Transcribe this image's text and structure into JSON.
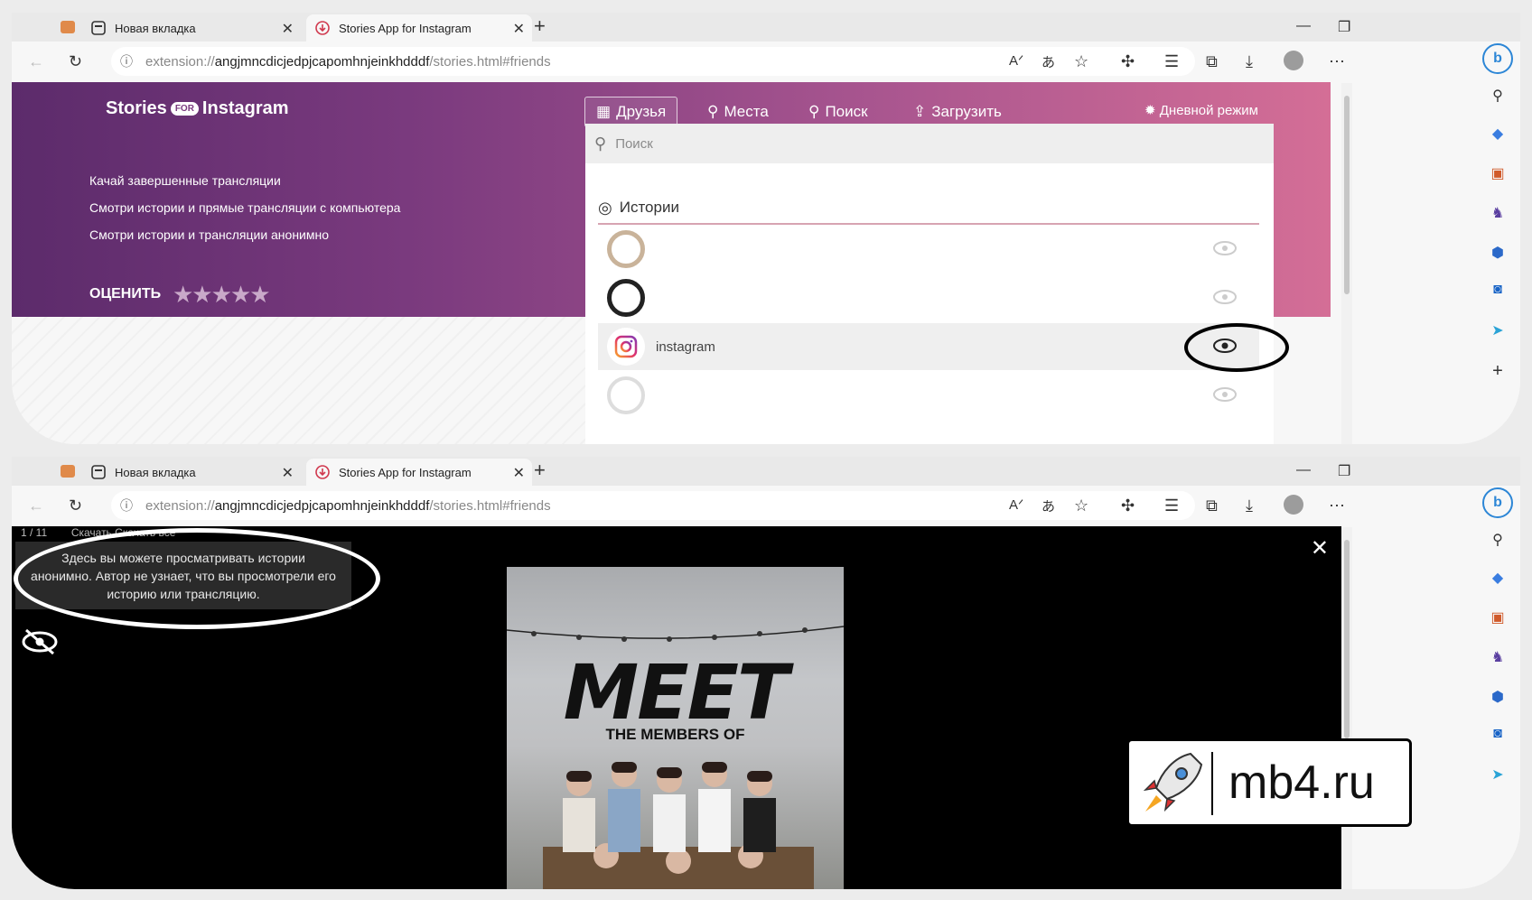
{
  "browser": {
    "tab1": {
      "label": "Новая вкладка"
    },
    "tab2": {
      "label": "Stories App for Instagram"
    },
    "url": {
      "prefix": "extension://",
      "host": "angjmncdicjedpjcapomhnjeinkhdddf",
      "path": "/stories.html#friends"
    }
  },
  "app": {
    "logo": {
      "left": "Stories",
      "badge": "FOR",
      "right": "Instagram"
    },
    "features": [
      "Качай завершенные трансляции",
      "Смотри истории и прямые трансляции с компьютера",
      "Смотри истории и трансляции анонимно"
    ],
    "rate_label": "ОЦЕНИТЬ",
    "stars": "★★★★★",
    "nav": {
      "friends": "Друзья",
      "places": "Места",
      "search": "Поиск",
      "upload": "Загрузить",
      "daymode": "Дневной режим"
    },
    "search_placeholder": "Поиск",
    "section_title": "Истории",
    "rows": [
      {
        "name": ""
      },
      {
        "name": ""
      },
      {
        "name": "instagram"
      },
      {
        "name": ""
      }
    ]
  },
  "viewer": {
    "counter": "1 / 11",
    "top_hint": "Скачать    Скачать все",
    "tooltip_lines": [
      "Здесь вы можете просматривать истории",
      "анонимно. Автор не узнает, что вы просмотрели его",
      "историю или трансляцию."
    ],
    "story_title": "MEET",
    "story_subtitle": "THE MEMBERS OF"
  },
  "watermark": "mb4.ru",
  "colors": {
    "hero_start": "#5c2b6b",
    "hero_end": "#d46e96",
    "accent": "#7a3a7e"
  }
}
